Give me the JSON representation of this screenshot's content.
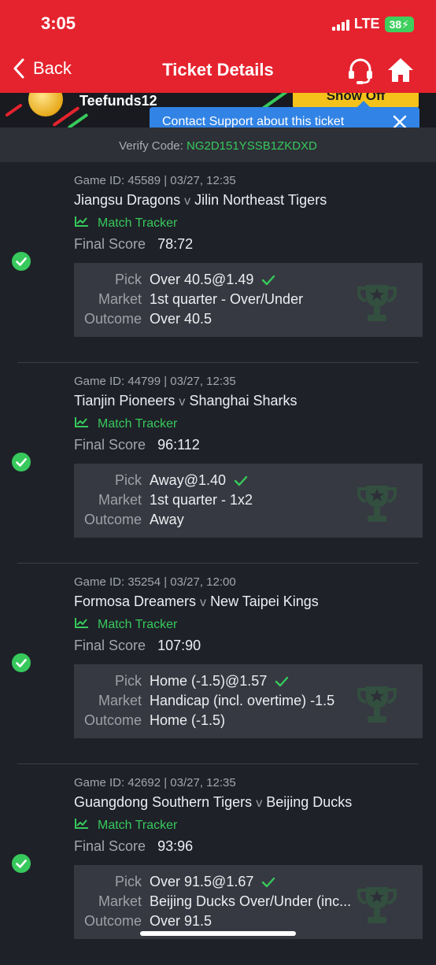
{
  "status": {
    "time": "3:05",
    "network": "LTE",
    "battery": "38"
  },
  "nav": {
    "back_label": "Back",
    "title": "Ticket Details"
  },
  "banner": {
    "username": "Teefunds12",
    "show_off": "Show Off"
  },
  "tooltip": {
    "text": "Contact Support about this ticket"
  },
  "verify": {
    "label": "Verify Code:",
    "code": "NG2D151YSSB1ZKDXD"
  },
  "labels": {
    "match_tracker": "Match Tracker",
    "final_score": "Final Score",
    "pick": "Pick",
    "market": "Market",
    "outcome": "Outcome",
    "vs": "v"
  },
  "colors": {
    "brand_red": "#e5232e",
    "win_green": "#37c95c",
    "tooltip_blue": "#3183e5",
    "show_off_yellow": "#f5c21b"
  },
  "tickets": [
    {
      "meta": "Game ID: 45589 | 03/27, 12:35",
      "home": "Jiangsu Dragons",
      "away": "Jilin Northeast Tigers",
      "score": "78:72",
      "pick": "Over 40.5@1.49",
      "market": "1st quarter - Over/Under",
      "outcome": "Over 40.5"
    },
    {
      "meta": "Game ID: 44799 | 03/27, 12:35",
      "home": "Tianjin Pioneers",
      "away": "Shanghai Sharks",
      "score": "96:112",
      "pick": "Away@1.40",
      "market": "1st quarter - 1x2",
      "outcome": "Away"
    },
    {
      "meta": "Game ID: 35254 | 03/27, 12:00",
      "home": "Formosa Dreamers",
      "away": "New Taipei Kings",
      "score": "107:90",
      "pick": "Home (-1.5)@1.57",
      "market": "Handicap (incl. overtime) -1.5",
      "outcome": "Home (-1.5)"
    },
    {
      "meta": "Game ID: 42692 | 03/27, 12:35",
      "home": "Guangdong Southern Tigers",
      "away": "Beijing Ducks",
      "score": "93:96",
      "pick": "Over 91.5@1.67",
      "market": "Beijing Ducks Over/Under (inc...",
      "outcome": "Over 91.5"
    }
  ]
}
